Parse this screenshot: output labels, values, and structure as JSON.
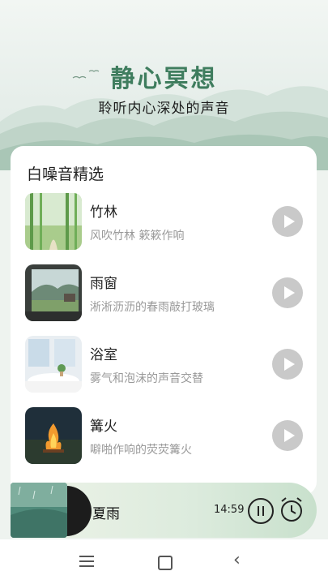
{
  "header": {
    "title": "静心冥想",
    "subtitle": "聆听内心深处的声音"
  },
  "section": {
    "title": "白噪音精选"
  },
  "sounds": [
    {
      "title": "竹林",
      "desc": "风吹竹林 簌簌作响",
      "thumb_icon": "bamboo-forest-image"
    },
    {
      "title": "雨窗",
      "desc": "淅淅沥沥的春雨敲打玻璃",
      "thumb_icon": "rainy-window-image"
    },
    {
      "title": "浴室",
      "desc": "雾气和泡沫的声音交替",
      "thumb_icon": "bathroom-image"
    },
    {
      "title": "篝火",
      "desc": "噼啪作响的荧荧篝火",
      "thumb_icon": "campfire-image"
    }
  ],
  "player": {
    "title": "夏雨",
    "time": "14:59",
    "state": "playing"
  },
  "colors": {
    "accent": "#3f7d5e",
    "play_button": "#c9c9c9"
  },
  "icons": [
    "play-icon",
    "pause-icon",
    "timer-clock-icon",
    "menu-icon",
    "home-icon",
    "back-icon"
  ]
}
